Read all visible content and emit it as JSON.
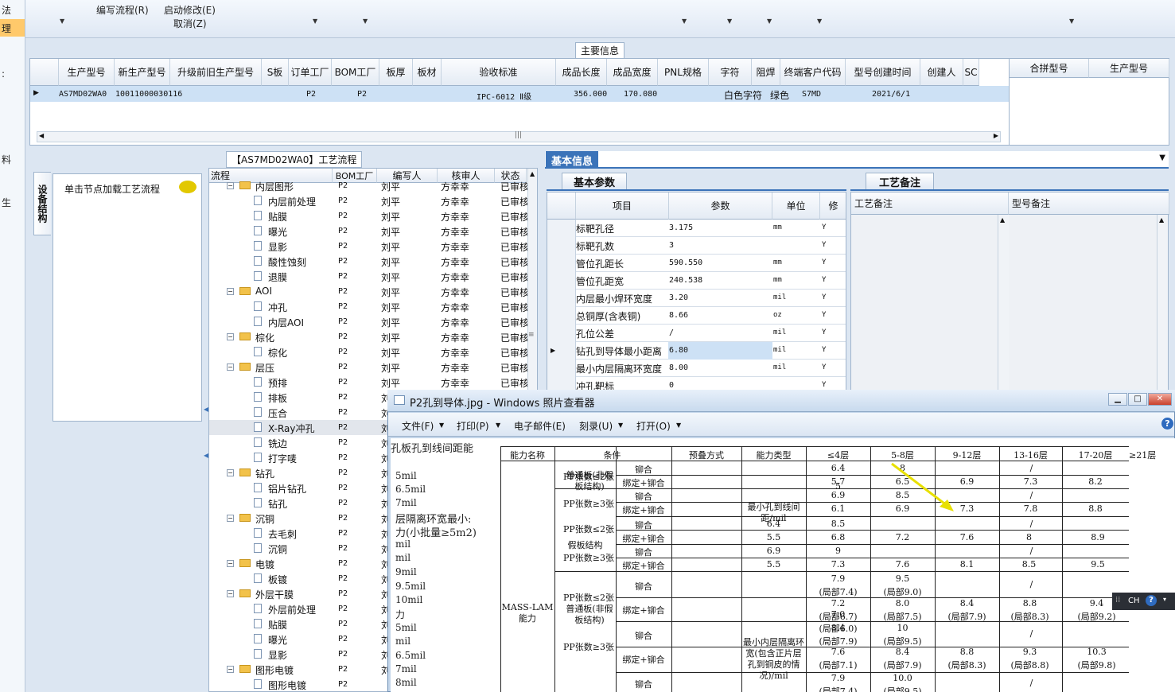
{
  "left_strip": {
    "items": [
      "法",
      "理",
      ":",
      "料",
      "生"
    ]
  },
  "toolbar": {
    "items": [
      {
        "label": "编写流程(R)"
      },
      {
        "label": "启动修改(E)"
      },
      {
        "label": "取消(Z)"
      }
    ]
  },
  "main_info": {
    "title": "主要信息",
    "columns": [
      "生产型号",
      "新生产型号",
      "升级前旧生产型号",
      "S板",
      "订单工厂",
      "BOM工厂",
      "板厚",
      "板材",
      "验收标准",
      "成品长度",
      "成品宽度",
      "PNL规格",
      "字符",
      "阻焊",
      "终端客户代码",
      "型号创建时间",
      "创建人",
      "SC"
    ],
    "row": {
      "model": "AS7MD02WA0",
      "new_model": "10011000030116",
      "order_factory": "P2",
      "bom_factory": "P2",
      "standard": "IPC-6012 Ⅱ级",
      "length": "356.000",
      "width": "170.080",
      "char": "白色字符",
      "mask": "绿色",
      "customer": "S7MD",
      "created": "2021/6/1"
    },
    "side_columns": [
      "合拼型号",
      "生产型号"
    ]
  },
  "process": {
    "title": "【AS7MD02WA0】工艺流程",
    "vertical_tab": "设备结构",
    "node_hint": "单击节点加载工艺流程",
    "columns": [
      "流程",
      "BOM工厂",
      "编写人",
      "核审人",
      "状态"
    ],
    "rows": [
      {
        "name": "内层图形",
        "type": "folder",
        "f": "P2",
        "w": "刘平",
        "r": "方幸幸",
        "s": "已审核"
      },
      {
        "name": "内层前处理",
        "type": "doc",
        "f": "P2",
        "w": "刘平",
        "r": "方幸幸",
        "s": "已审核"
      },
      {
        "name": "贴膜",
        "type": "doc",
        "f": "P2",
        "w": "刘平",
        "r": "方幸幸",
        "s": "已审核"
      },
      {
        "name": "曝光",
        "type": "doc",
        "f": "P2",
        "w": "刘平",
        "r": "方幸幸",
        "s": "已审核"
      },
      {
        "name": "显影",
        "type": "doc",
        "f": "P2",
        "w": "刘平",
        "r": "方幸幸",
        "s": "已审核"
      },
      {
        "name": "酸性蚀刻",
        "type": "doc",
        "f": "P2",
        "w": "刘平",
        "r": "方幸幸",
        "s": "已审核"
      },
      {
        "name": "退膜",
        "type": "doc",
        "f": "P2",
        "w": "刘平",
        "r": "方幸幸",
        "s": "已审核"
      },
      {
        "name": "AOI",
        "type": "folder",
        "f": "P2",
        "w": "刘平",
        "r": "方幸幸",
        "s": "已审核"
      },
      {
        "name": "冲孔",
        "type": "doc",
        "f": "P2",
        "w": "刘平",
        "r": "方幸幸",
        "s": "已审核"
      },
      {
        "name": "内层AOI",
        "type": "doc",
        "f": "P2",
        "w": "刘平",
        "r": "方幸幸",
        "s": "已审核"
      },
      {
        "name": "棕化",
        "type": "folder",
        "f": "P2",
        "w": "刘平",
        "r": "方幸幸",
        "s": "已审核"
      },
      {
        "name": "棕化",
        "type": "doc",
        "f": "P2",
        "w": "刘平",
        "r": "方幸幸",
        "s": "已审核"
      },
      {
        "name": "层压",
        "type": "folder",
        "f": "P2",
        "w": "刘平",
        "r": "方幸幸",
        "s": "已审核"
      },
      {
        "name": "预排",
        "type": "doc",
        "f": "P2",
        "w": "刘平",
        "r": "方幸幸",
        "s": "已审核"
      },
      {
        "name": "排板",
        "type": "doc",
        "f": "P2",
        "w": "刘",
        "r": "",
        "s": ""
      },
      {
        "name": "压合",
        "type": "doc",
        "f": "P2",
        "w": "刘",
        "r": "",
        "s": ""
      },
      {
        "name": "X-Ray冲孔",
        "type": "doc",
        "f": "P2",
        "w": "刘",
        "r": "",
        "s": ""
      },
      {
        "name": "铣边",
        "type": "doc",
        "f": "P2",
        "w": "刘",
        "r": "",
        "s": ""
      },
      {
        "name": "打字唛",
        "type": "doc",
        "f": "P2",
        "w": "刘",
        "r": "",
        "s": ""
      },
      {
        "name": "钻孔",
        "type": "folder",
        "f": "P2",
        "w": "刘",
        "r": "",
        "s": ""
      },
      {
        "name": "铝片钻孔",
        "type": "doc",
        "f": "P2",
        "w": "刘",
        "r": "",
        "s": ""
      },
      {
        "name": "钻孔",
        "type": "doc",
        "f": "P2",
        "w": "刘",
        "r": "",
        "s": ""
      },
      {
        "name": "沉铜",
        "type": "folder",
        "f": "P2",
        "w": "刘",
        "r": "",
        "s": ""
      },
      {
        "name": "去毛刺",
        "type": "doc",
        "f": "P2",
        "w": "刘",
        "r": "",
        "s": ""
      },
      {
        "name": "沉铜",
        "type": "doc",
        "f": "P2",
        "w": "刘",
        "r": "",
        "s": ""
      },
      {
        "name": "电镀",
        "type": "folder",
        "f": "P2",
        "w": "刘",
        "r": "",
        "s": ""
      },
      {
        "name": "板镀",
        "type": "doc",
        "f": "P2",
        "w": "刘",
        "r": "",
        "s": ""
      },
      {
        "name": "外层干膜",
        "type": "folder",
        "f": "P2",
        "w": "刘",
        "r": "",
        "s": ""
      },
      {
        "name": "外层前处理",
        "type": "doc",
        "f": "P2",
        "w": "刘",
        "r": "",
        "s": ""
      },
      {
        "name": "贴膜",
        "type": "doc",
        "f": "P2",
        "w": "刘",
        "r": "",
        "s": ""
      },
      {
        "name": "曝光",
        "type": "doc",
        "f": "P2",
        "w": "刘",
        "r": "",
        "s": ""
      },
      {
        "name": "显影",
        "type": "doc",
        "f": "P2",
        "w": "刘",
        "r": "",
        "s": ""
      },
      {
        "name": "图形电镀",
        "type": "folder",
        "f": "P2",
        "w": "刘",
        "r": "",
        "s": ""
      },
      {
        "name": "图形电镀",
        "type": "doc",
        "f": "P2",
        "w": "",
        "r": "",
        "s": ""
      }
    ]
  },
  "basic": {
    "tab": "基本信息",
    "subtab_params": "基本参数",
    "subtab_notes": "工艺备注",
    "columns": [
      "项目",
      "参数",
      "单位",
      "修"
    ],
    "params": [
      {
        "k": "标靶孔径",
        "v": "3.175",
        "u": "mm",
        "y": "Y"
      },
      {
        "k": "标靶孔数",
        "v": "3",
        "u": "",
        "y": "Y"
      },
      {
        "k": "管位孔距长",
        "v": "590.550",
        "u": "mm",
        "y": "Y"
      },
      {
        "k": "管位孔距宽",
        "v": "240.538",
        "u": "mm",
        "y": "Y"
      },
      {
        "k": "内层最小焊环宽度",
        "v": "3.20",
        "u": "mil",
        "y": "Y"
      },
      {
        "k": "总铜厚(含表铜)",
        "v": "8.66",
        "u": "oz",
        "y": "Y"
      },
      {
        "k": "孔位公差",
        "v": "/",
        "u": "mil",
        "y": "Y"
      },
      {
        "k": "钻孔到导体最小距离",
        "v": "6.80",
        "u": "mil",
        "y": "Y"
      },
      {
        "k": "最小内层隔离环宽度",
        "v": "8.00",
        "u": "mil",
        "y": "Y"
      },
      {
        "k": "冲孔靶标",
        "v": "0",
        "u": "",
        "y": "Y"
      }
    ],
    "note_columns": [
      "工艺备注",
      "型号备注"
    ]
  },
  "viewer": {
    "title": "P2孔到导体.jpg - Windows 照片查看器",
    "menu": [
      "文件(F)",
      "打印(P)",
      "电子邮件(E)",
      "刻录(U)",
      "打开(O)"
    ],
    "ime": "CH"
  },
  "photo": {
    "left_text": [
      "孔板孔到线间距能",
      "5mil",
      "6.5mil",
      "7mil",
      "层隔离环宽最小:",
      "力(小批量≥5m2)",
      "mil",
      "mil",
      "9mil",
      "9.5mil",
      "10mil",
      "力",
      "5mil",
      "mil",
      "6.5mil",
      "7mil",
      "8mil"
    ],
    "headers": [
      "能力名称",
      "条件",
      "预叠方式",
      "能力类型",
      "≤4层",
      "5-8层",
      "9-12层",
      "13-16层",
      "17-20层",
      "≥21层"
    ],
    "labels": {
      "normal": "普通板(非假板结构)",
      "fake": "假板结构",
      "pp_le2": "PP张数≤2张",
      "pp_ge3": "PP张数≥3张",
      "rivet": "铆合",
      "bind": "绑定+铆合",
      "type1": "最小孔到线间距/mil",
      "type2": "最小内层隔离环宽(包含正片层孔到铜皮的情况)/mil",
      "mass": "MASS-LAM能力",
      "slash": "/"
    },
    "values1": [
      [
        "6.4",
        "8",
        "",
        "",
        ""
      ],
      [
        "5.7",
        "6.5",
        "6.9",
        "7.3",
        "8.2"
      ],
      [
        "6.9",
        "8.5",
        "",
        "",
        ""
      ],
      [
        "6.1",
        "6.9",
        "7.3",
        "7.8",
        "8.8"
      ]
    ],
    "le4_a": "5",
    "fake_vals": [
      [
        "6.4",
        "8.5"
      ],
      [
        "5.5",
        "6.8",
        "7.2",
        "7.6",
        "8",
        "8.9"
      ],
      [
        "6.9",
        "9"
      ],
      [
        "5.5",
        "7.3",
        "7.6",
        "8.1",
        "8.5",
        "9.5"
      ]
    ],
    "iso": {
      "le4": "7.0",
      "le4_sub": "(局部6.0)",
      "r1": [
        "7.9",
        "(局部7.4)",
        "9.5",
        "(局部9.0)"
      ],
      "r2": [
        "7.2",
        "(局部6.7)",
        "8.0",
        "(局部7.5)",
        "8.4",
        "(局部7.9)",
        "8.8",
        "(局部8.3)",
        "9.4",
        "(局部9.2)"
      ],
      "r3": [
        "8.4",
        "(局部7.9)",
        "10",
        "(局部9.5)"
      ],
      "r4": [
        "7.6",
        "(局部7.1)",
        "8.4",
        "(局部7.9)",
        "8.8",
        "(局部8.3)",
        "9.3",
        "(局部8.8)",
        "10.3",
        "(局部9.8)"
      ],
      "r5": [
        "7.9",
        "(局部7.4)",
        "10.0",
        "(局部9.5)"
      ]
    }
  }
}
